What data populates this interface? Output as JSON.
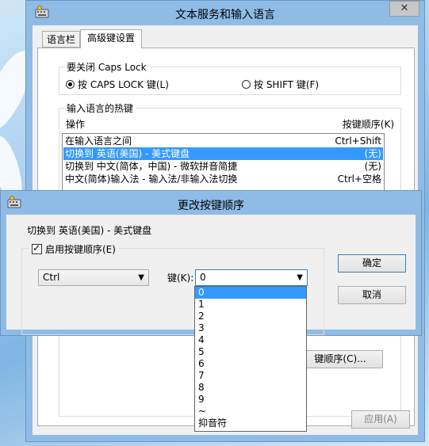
{
  "back_dialog": {
    "title": "文本服务和输入语言",
    "close_glyph": "✕",
    "tabs": [
      {
        "label": "语言栏"
      },
      {
        "label": "高级键设置"
      }
    ],
    "caps_group": {
      "label": "要关闭 Caps Lock",
      "options": [
        {
          "label": "按 CAPS LOCK 键(L)",
          "checked": true
        },
        {
          "label": "按 SHIFT 键(F)",
          "checked": false
        }
      ]
    },
    "hotkey_group": {
      "label": "输入语言的热键",
      "col_action": "操作",
      "col_sequence": "按键顺序(K)",
      "rows": [
        {
          "action": "在输入语言之间",
          "keys": "Ctrl+Shift"
        },
        {
          "action": "切换到 英语(美国) - 美式键盘",
          "keys": "(无)",
          "selected": true
        },
        {
          "action": "切换到 中文(简体，中国) - 微软拼音简捷",
          "keys": "(无)"
        },
        {
          "action": "中文(简体)输入法 - 输入法/非输入法切换",
          "keys": "Ctrl+空格"
        }
      ],
      "change_button": "键顺序(C)..."
    },
    "buttons": {
      "apply": "应用(A)"
    }
  },
  "front_dialog": {
    "title": "更改按键顺序",
    "subtitle": "切换到 英语(美国) - 美式键盘",
    "enable_label": "启用按键顺序(E)",
    "enable_checked": true,
    "modifier_value": "Ctrl",
    "key_label": "键(K):",
    "key_value": "0",
    "ok": "确定",
    "cancel": "取消",
    "dropdown_options": [
      "0",
      "1",
      "2",
      "3",
      "4",
      "5",
      "6",
      "7",
      "8",
      "9",
      "~",
      "抑音符"
    ],
    "dropdown_selected": "0"
  },
  "colors": {
    "selection": "#3399ff",
    "title_bar": "#8ebce6"
  }
}
